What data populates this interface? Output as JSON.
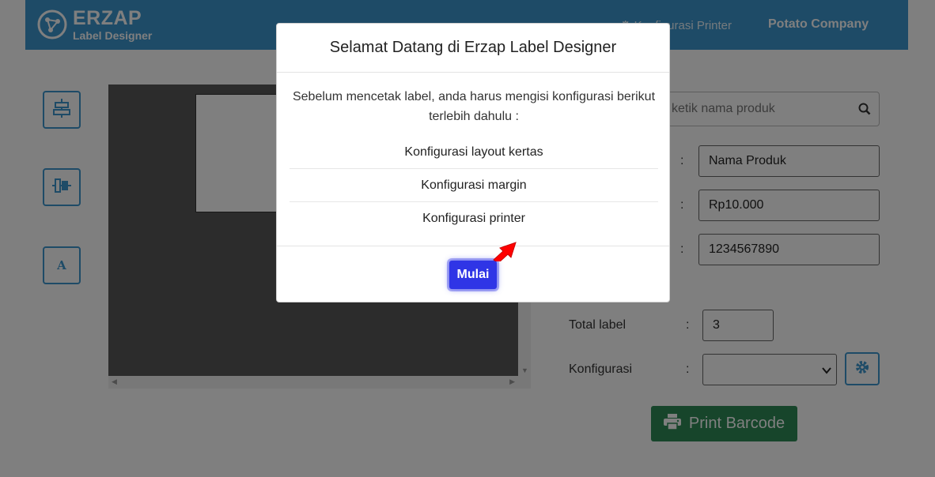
{
  "header": {
    "logo_title": "ERZAP",
    "logo_subtitle": "Label Designer",
    "nav_printer": "⚙ Konfigurasi Printer",
    "company": "Potato Company",
    "accent_color": "#3d97cf"
  },
  "tools": [
    {
      "name": "align-vertical-center-icon"
    },
    {
      "name": "align-horizontal-center-icon"
    },
    {
      "name": "text-tool",
      "label": "A"
    }
  ],
  "search": {
    "placeholder": "Ketik nama produk",
    "visible_text": "ketik nama produk",
    "icon": "search-icon"
  },
  "form": {
    "colon": ":",
    "product_name": "Nama Produk",
    "price": "Rp10.000",
    "barcode": "1234567890",
    "total_label_text": "Total label",
    "total_label_value": "3",
    "config_text": "Konfigurasi",
    "config_selected": ""
  },
  "print_button": {
    "label": "Print Barcode",
    "icon": "printer-icon",
    "color": "#2e8b57"
  },
  "modal": {
    "title": "Selamat Datang di Erzap Label Designer",
    "intro": "Sebelum mencetak label, anda harus mengisi konfigurasi berikut terlebih dahulu :",
    "items": [
      "Konfigurasi layout kertas",
      "Konfigurasi margin",
      "Konfigurasi printer"
    ],
    "start_button": "Mulai",
    "start_button_color": "#2f35e6"
  },
  "annotation": {
    "arrow_color": "#ff0000"
  }
}
